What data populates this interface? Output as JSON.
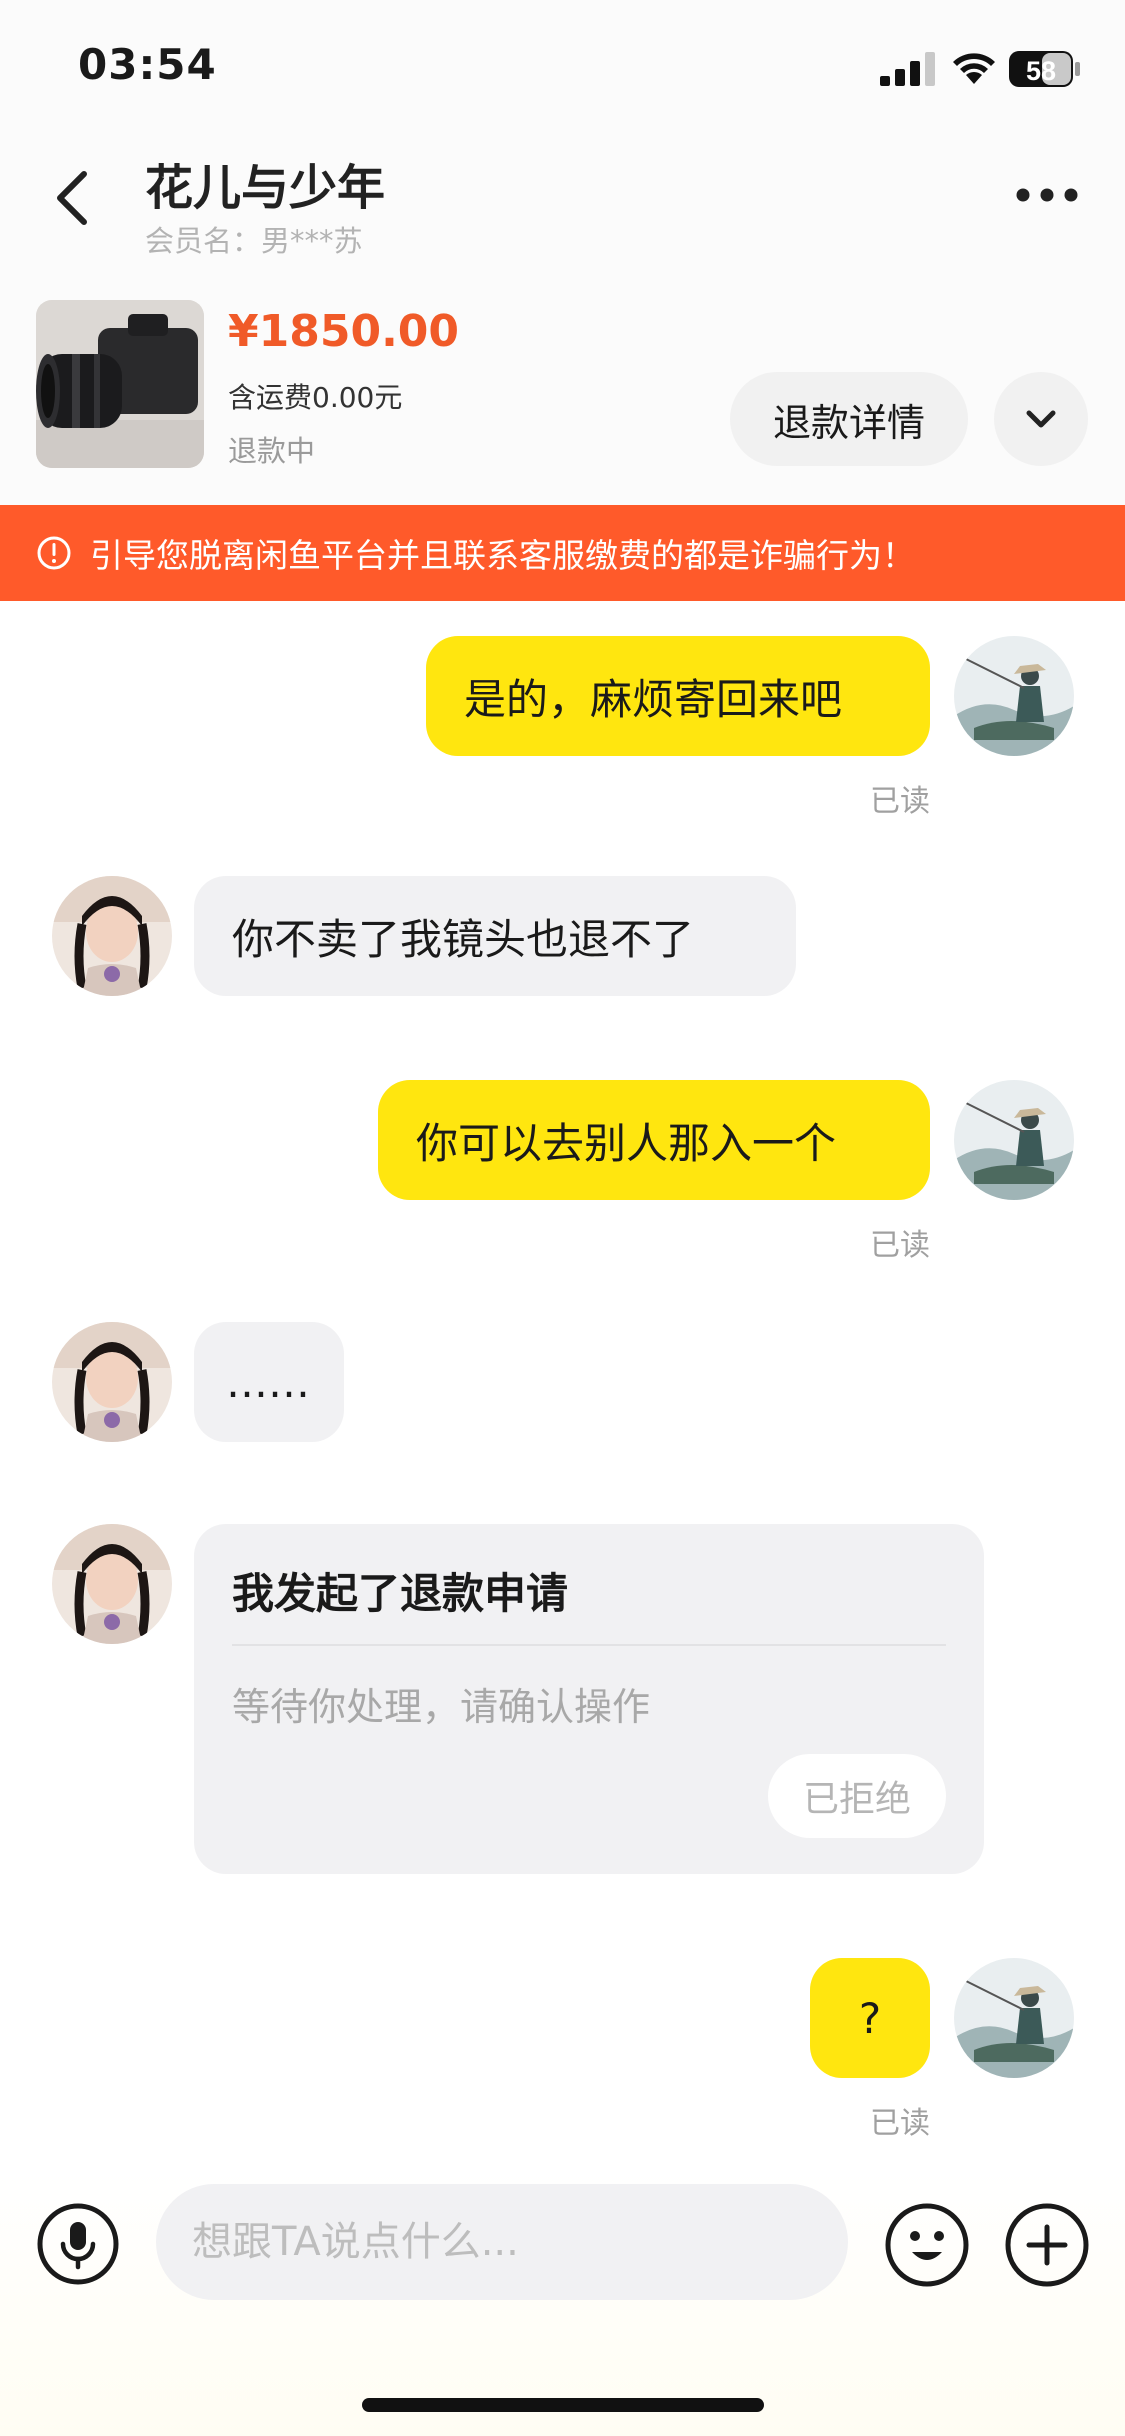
{
  "status_bar": {
    "time": "03:54",
    "battery": "58"
  },
  "header": {
    "title": "花儿与少年",
    "member_name": "会员名：男***苏"
  },
  "product": {
    "price": "¥1850.00",
    "shipping": "含运费0.00元",
    "status": "退款中",
    "refund_detail_label": "退款详情"
  },
  "warning": {
    "text": "引导您脱离闲鱼平台并且联系客服缴费的都是诈骗行为！"
  },
  "messages": [
    {
      "side": "out",
      "text": "是的，麻烦寄回来吧",
      "read": "已读"
    },
    {
      "side": "in",
      "text": "你不卖了我镜头也退不了"
    },
    {
      "side": "out",
      "text": "你可以去别人那入一个",
      "read": "已读"
    },
    {
      "side": "in",
      "text": "……"
    },
    {
      "side": "in",
      "card": {
        "title": "我发起了退款申请",
        "subtitle": "等待你处理，请确认操作",
        "status": "已拒绝"
      }
    },
    {
      "side": "out",
      "text": "?",
      "read": "已读"
    }
  ],
  "input": {
    "placeholder": "想跟TA说点什么..."
  },
  "colors": {
    "accent_yellow": "#ffe60f",
    "warning_orange": "#ff5a2a",
    "price_orange": "#f05a28"
  }
}
